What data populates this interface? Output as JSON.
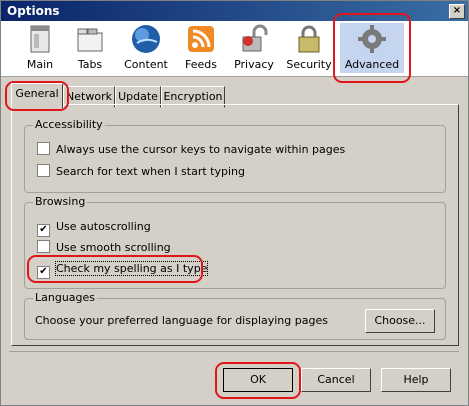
{
  "window": {
    "title": "Options",
    "close_glyph": "×"
  },
  "toolbar": [
    {
      "label": "Main",
      "icon": "main-window-icon",
      "selected": false
    },
    {
      "label": "Tabs",
      "icon": "tabs-icon",
      "selected": false
    },
    {
      "label": "Content",
      "icon": "globe-icon",
      "selected": false
    },
    {
      "label": "Feeds",
      "icon": "rss-feed-icon",
      "selected": false
    },
    {
      "label": "Privacy",
      "icon": "privacy-lock-icon",
      "selected": false
    },
    {
      "label": "Security",
      "icon": "security-padlock-icon",
      "selected": false
    },
    {
      "label": "Advanced",
      "icon": "gear-icon",
      "selected": true
    }
  ],
  "tabs": [
    {
      "label": "General",
      "active": true
    },
    {
      "label": "Network",
      "active": false
    },
    {
      "label": "Update",
      "active": false
    },
    {
      "label": "Encryption",
      "active": false
    }
  ],
  "accessibility": {
    "title": "Accessibility",
    "options": [
      {
        "label": "Always use the cursor keys to navigate within pages",
        "checked": false
      },
      {
        "label": "Search for text when I start typing",
        "checked": false
      }
    ]
  },
  "browsing": {
    "title": "Browsing",
    "options": [
      {
        "label": "Use autoscrolling",
        "checked": true
      },
      {
        "label": "Use smooth scrolling",
        "checked": false
      },
      {
        "label": "Check my spelling as I type",
        "checked": true
      }
    ]
  },
  "languages": {
    "title": "Languages",
    "description": "Choose your preferred language for displaying pages",
    "choose_label": "Choose..."
  },
  "buttons": {
    "ok": "OK",
    "cancel": "Cancel",
    "help": "Help"
  },
  "colors": {
    "highlight": "#e0161b",
    "selected_toolbar": "#c5d4ef",
    "title_gradient_start": "#0a246a"
  }
}
